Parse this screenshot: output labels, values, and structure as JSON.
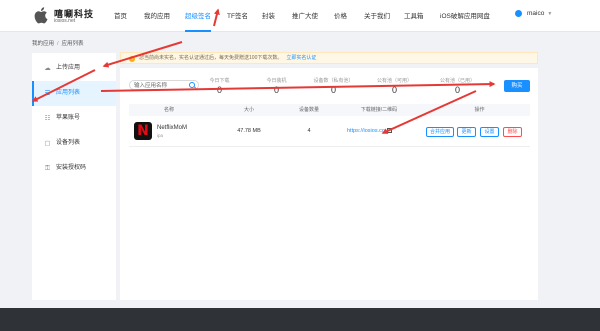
{
  "brand": {
    "title": "嘻唰科技",
    "subtitle": "iosios.net"
  },
  "nav": {
    "items": [
      "首页",
      "我的应用",
      "超级签名",
      "TF签名",
      "封装",
      "推广大使",
      "价格",
      "关于我们",
      "工具箱",
      "iOS破解应用网盘"
    ],
    "active_index": 2,
    "user": "maico"
  },
  "breadcrumb": [
    "我的应用",
    "应用列表"
  ],
  "notice": {
    "text": "您当前尚未实名，实名认证通过后，每天免费赠送100下载次数。",
    "link": "立即实名认证"
  },
  "sidebar": {
    "items": [
      {
        "label": "上传应用",
        "icon": "cloud-upload-icon"
      },
      {
        "label": "应用列表",
        "icon": "list-icon"
      },
      {
        "label": "苹果账号",
        "icon": "apple-id-icon"
      },
      {
        "label": "设备列表",
        "icon": "devices-icon"
      },
      {
        "label": "安装授权码",
        "icon": "key-icon"
      }
    ],
    "active_index": 1
  },
  "search": {
    "placeholder": "输入应用名称"
  },
  "stats": [
    {
      "label": "今日下载",
      "value": "0"
    },
    {
      "label": "今日装机",
      "value": "0"
    },
    {
      "label": "设备数（私有池）",
      "value": "0"
    },
    {
      "label": "公有池（可用）",
      "value": "0"
    },
    {
      "label": "公有池（已用）",
      "value": "0"
    }
  ],
  "buy_label": "购买",
  "table": {
    "headers": [
      "名称",
      "大小",
      "设备数量",
      "下载链接/二维码",
      "操作"
    ],
    "rows": [
      {
        "name": "NetflixMoM",
        "sub": "ipa",
        "icon_letter": "N",
        "size": "47.78 MB",
        "devices": "4",
        "link": "https://iosios.co",
        "actions": [
          "合并应用",
          "更新",
          "设置",
          "删除"
        ]
      }
    ]
  },
  "colors": {
    "accent": "#1890ff",
    "danger": "#ff4d4f",
    "arrow": "#e53935",
    "footer": "#2f3236"
  }
}
